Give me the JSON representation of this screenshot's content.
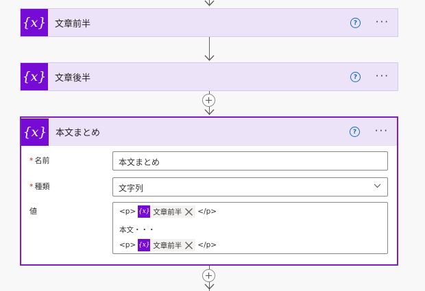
{
  "cards": [
    {
      "title": "文章前半",
      "icon": "variable-icon"
    },
    {
      "title": "文章後半",
      "icon": "variable-icon"
    },
    {
      "title": "本文まとめ",
      "icon": "variable-icon"
    }
  ],
  "badge_text": "{x}",
  "help_glyph": "?",
  "more_glyph": "···",
  "form": {
    "name": {
      "label": "名前",
      "required": "*",
      "value": "本文まとめ"
    },
    "type": {
      "label": "種類",
      "required": "*",
      "value": "文字列"
    },
    "value": {
      "label": "値",
      "lines": [
        {
          "before": "<p>",
          "token": "文章前半",
          "after": "</p>"
        },
        {
          "text": "本文・・・"
        },
        {
          "before": "<p>",
          "token": "文章前半",
          "after": "</p>"
        }
      ]
    }
  },
  "colors": {
    "accent": "#770bd6",
    "card_bg": "#ece3f8",
    "border_selected": "#7a1fc8"
  }
}
